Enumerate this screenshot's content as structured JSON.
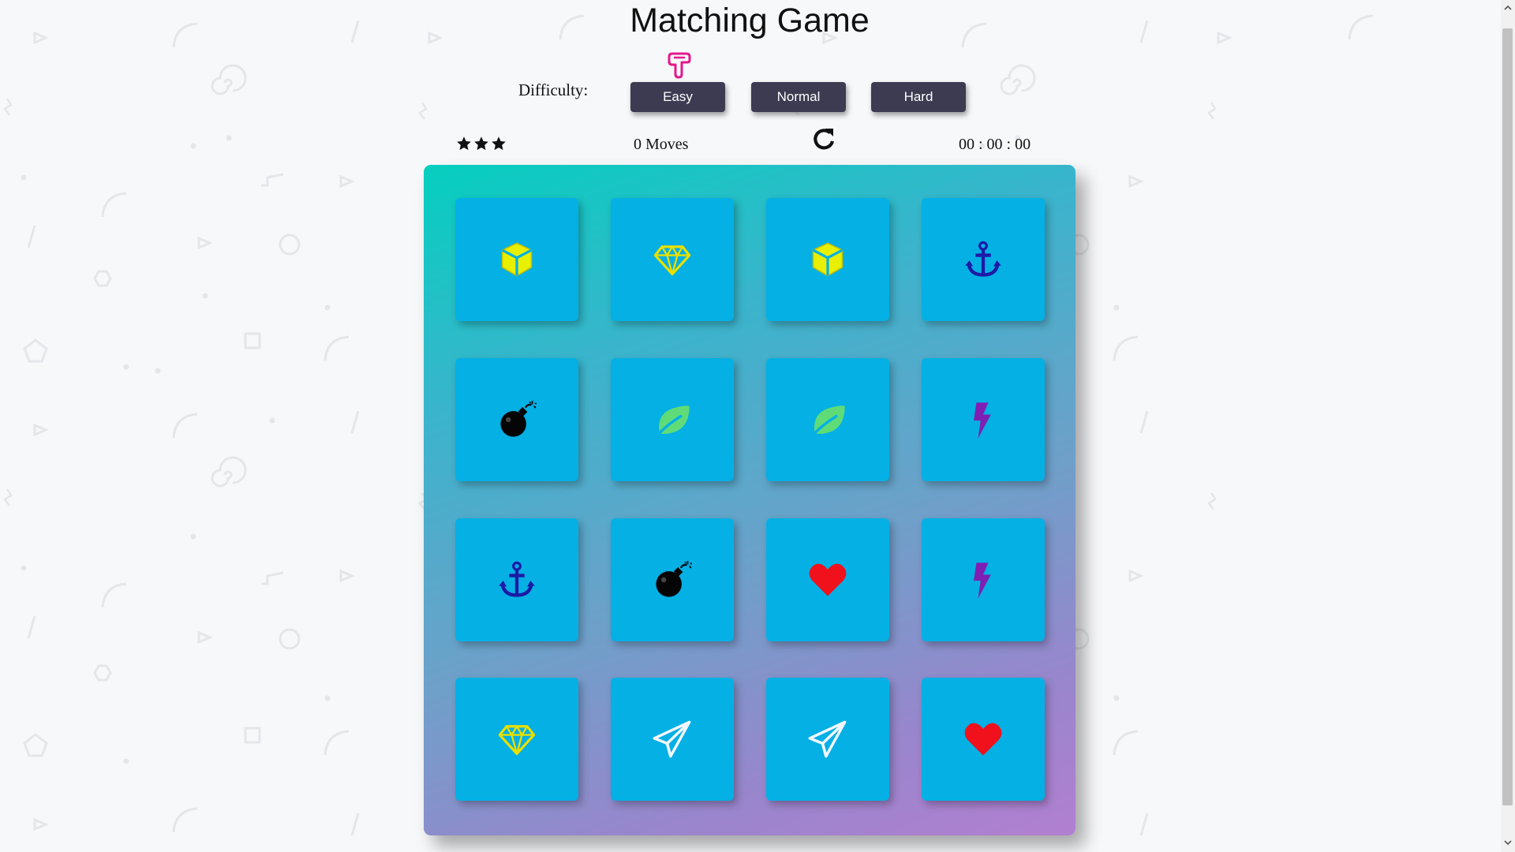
{
  "title": "Matching Game",
  "difficulty": {
    "label": "Difficulty:",
    "selected": "Easy",
    "options": [
      "Easy",
      "Normal",
      "Hard"
    ]
  },
  "score_panel": {
    "stars": 3,
    "moves_count": "0",
    "moves_label": "Moves",
    "timer": "00 : 00 : 00"
  },
  "colors": {
    "card": "#04b0e4",
    "button": "#3c3b52",
    "pointer": "#e6178c"
  },
  "deck": {
    "cards": [
      [
        "cube-icon",
        "diamond-icon",
        "cube-icon",
        "anchor-icon"
      ],
      [
        "bomb-icon",
        "leaf-icon",
        "leaf-icon",
        "bolt-icon"
      ],
      [
        "anchor-icon",
        "bomb-icon",
        "heart-icon",
        "bolt-icon"
      ],
      [
        "diamond-icon",
        "paper-plane-icon",
        "paper-plane-icon",
        "heart-icon"
      ]
    ]
  }
}
